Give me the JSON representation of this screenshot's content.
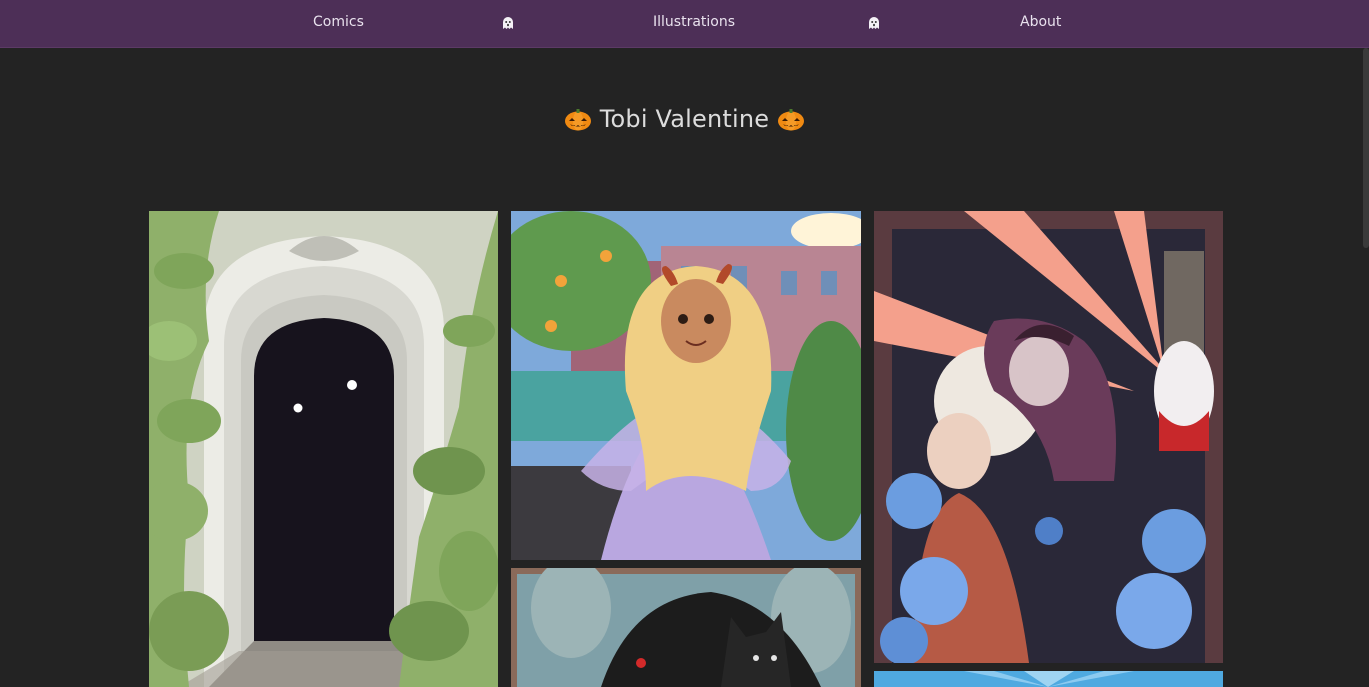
{
  "nav": {
    "items": [
      {
        "label": "Comics"
      },
      {
        "label": "Illustrations"
      },
      {
        "label": "About"
      }
    ],
    "separator_icon": "ghost-icon",
    "background": "#4d2f57"
  },
  "header": {
    "title": "Tobi Valentine",
    "emoji_icon": "pumpkin-icon"
  },
  "gallery": {
    "images": [
      {
        "name": "archway-illustration",
        "subject": "stone archway overgrown with plants"
      },
      {
        "name": "demon-girl-illustration",
        "subject": "horned girl in lavender dress"
      },
      {
        "name": "vampire-clock-illustration",
        "subject": "vampire with clock and monk among blue roses"
      },
      {
        "name": "black-cat-illustration",
        "subject": "black cat with red eyes"
      },
      {
        "name": "sunburst-illustration",
        "subject": "blue sunburst"
      }
    ]
  },
  "colors": {
    "page_background": "#232323",
    "nav_background": "#4d2f57",
    "title_text": "#dcdcdc"
  }
}
